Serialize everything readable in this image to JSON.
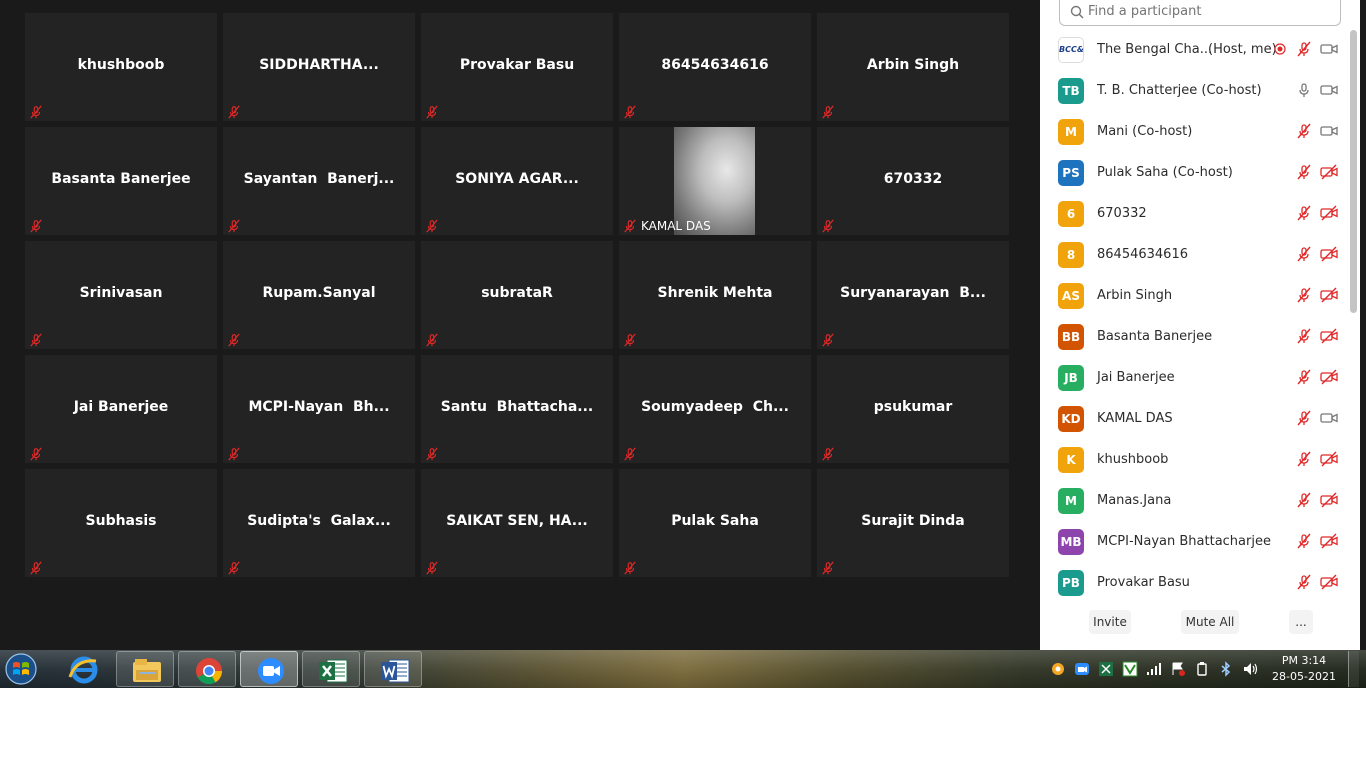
{
  "gallery": {
    "rows": [
      [
        {
          "name": "khushboob"
        },
        {
          "name": "SIDDHARTHA..."
        },
        {
          "name": "Provakar Basu"
        },
        {
          "name": "86454634616"
        },
        {
          "name": "Arbin Singh"
        }
      ],
      [
        {
          "name": "Basanta Banerjee"
        },
        {
          "name": "Sayantan  Banerj..."
        },
        {
          "name": "SONIYA AGAR..."
        },
        {
          "name": "KAMAL DAS",
          "video": true
        },
        {
          "name": "670332"
        }
      ],
      [
        {
          "name": "Srinivasan"
        },
        {
          "name": "Rupam.Sanyal"
        },
        {
          "name": "subrataR"
        },
        {
          "name": "Shrenik Mehta"
        },
        {
          "name": "Suryanarayan  B..."
        }
      ],
      [
        {
          "name": "Jai Banerjee"
        },
        {
          "name": "MCPI-Nayan  Bh..."
        },
        {
          "name": "Santu  Bhattacha..."
        },
        {
          "name": "Soumyadeep  Ch..."
        },
        {
          "name": "psukumar"
        }
      ],
      [
        {
          "name": "Subhasis"
        },
        {
          "name": "Sudipta's  Galax..."
        },
        {
          "name": "SAIKAT SEN, HA..."
        },
        {
          "name": "Pulak Saha"
        },
        {
          "name": "Surajit Dinda"
        }
      ]
    ],
    "muted_icon": "muted-mic-icon"
  },
  "participants_panel": {
    "search_placeholder": "Find a participant",
    "participants": [
      {
        "initials": "BCC&",
        "name": "The Bengal Cha...",
        "tag": "(Host, me)",
        "color": "#ffffff",
        "logo": true,
        "recording": true,
        "mic": "muted",
        "video": "on"
      },
      {
        "initials": "TB",
        "name": "T. B. Chatterjee (Co-host)",
        "color": "#1b9a8e",
        "mic": "on",
        "video": "on"
      },
      {
        "initials": "M",
        "name": "Mani (Co-host)",
        "color": "#f0a30a",
        "mic": "muted",
        "video": "on"
      },
      {
        "initials": "PS",
        "name": "Pulak Saha (Co-host)",
        "color": "#1e73be",
        "mic": "muted",
        "video": "off"
      },
      {
        "initials": "6",
        "name": "670332",
        "color": "#f0a30a",
        "mic": "muted",
        "video": "off"
      },
      {
        "initials": "8",
        "name": "86454634616",
        "color": "#f0a30a",
        "mic": "muted",
        "video": "off"
      },
      {
        "initials": "AS",
        "name": "Arbin Singh",
        "color": "#f0a30a",
        "mic": "muted",
        "video": "off"
      },
      {
        "initials": "BB",
        "name": "Basanta Banerjee",
        "color": "#d35400",
        "mic": "muted",
        "video": "off"
      },
      {
        "initials": "JB",
        "name": "Jai Banerjee",
        "color": "#27ae60",
        "mic": "muted",
        "video": "off"
      },
      {
        "initials": "KD",
        "name": "KAMAL DAS",
        "color": "#d35400",
        "mic": "muted",
        "video": "on"
      },
      {
        "initials": "K",
        "name": "khushboob",
        "color": "#f0a30a",
        "mic": "muted",
        "video": "off"
      },
      {
        "initials": "M",
        "name": "Manas.Jana",
        "color": "#27ae60",
        "mic": "muted",
        "video": "off"
      },
      {
        "initials": "MB",
        "name": "MCPI-Nayan Bhattacharjee",
        "color": "#8e44ad",
        "mic": "muted",
        "video": "off"
      },
      {
        "initials": "PB",
        "name": "Provakar Basu",
        "color": "#1b9a8e",
        "mic": "muted",
        "video": "off"
      }
    ],
    "footer": {
      "invite_label": "Invite",
      "mute_all_label": "Mute All",
      "more_label": "..."
    }
  },
  "taskbar": {
    "apps": [
      {
        "name": "internet-explorer-icon"
      },
      {
        "name": "file-explorer-icon"
      },
      {
        "name": "chrome-icon"
      },
      {
        "name": "zoom-icon"
      },
      {
        "name": "excel-icon"
      },
      {
        "name": "word-icon"
      }
    ],
    "clock_time": "PM 3:14",
    "clock_date": "28-05-2021"
  },
  "colors": {
    "muted_red": "#e02828",
    "zoom_blue": "#2d8cff"
  }
}
